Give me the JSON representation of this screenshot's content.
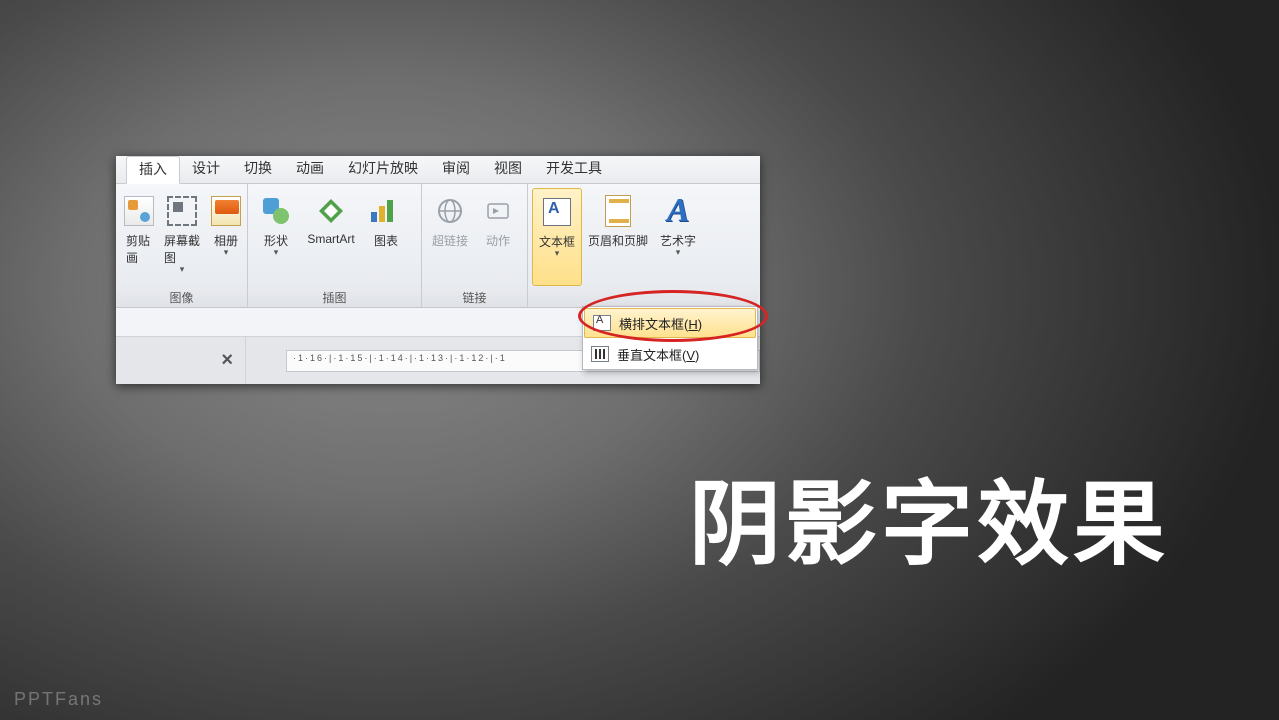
{
  "title": "阴影字效果",
  "watermark": "PPTFans",
  "tabs": [
    {
      "label": "插入",
      "active": true
    },
    {
      "label": "设计"
    },
    {
      "label": "切换"
    },
    {
      "label": "动画"
    },
    {
      "label": "幻灯片放映"
    },
    {
      "label": "审阅"
    },
    {
      "label": "视图"
    },
    {
      "label": "开发工具"
    }
  ],
  "groups": {
    "images": {
      "label": "图像",
      "buttons": {
        "clipart": "剪贴画",
        "screenshot": "屏幕截图",
        "album": "相册"
      }
    },
    "illustrations": {
      "label": "插图",
      "buttons": {
        "shapes": "形状",
        "smartart": "SmartArt",
        "chart": "图表"
      }
    },
    "links": {
      "label": "链接",
      "buttons": {
        "hyperlink": "超链接",
        "action": "动作"
      }
    },
    "text": {
      "label": "",
      "buttons": {
        "textbox": "文本框",
        "headerfooter": "页眉和页脚",
        "wordart": "艺术字"
      }
    }
  },
  "dropdown": {
    "horizontal_pre": "横排文本框(",
    "horizontal_key": "H",
    "horizontal_post": ")",
    "vertical_pre": "垂直文本框(",
    "vertical_key": "V",
    "vertical_post": ")"
  },
  "ruler": "·1·16·|·1·15·|·1·14·|·1·13·|·1·12·|·1"
}
